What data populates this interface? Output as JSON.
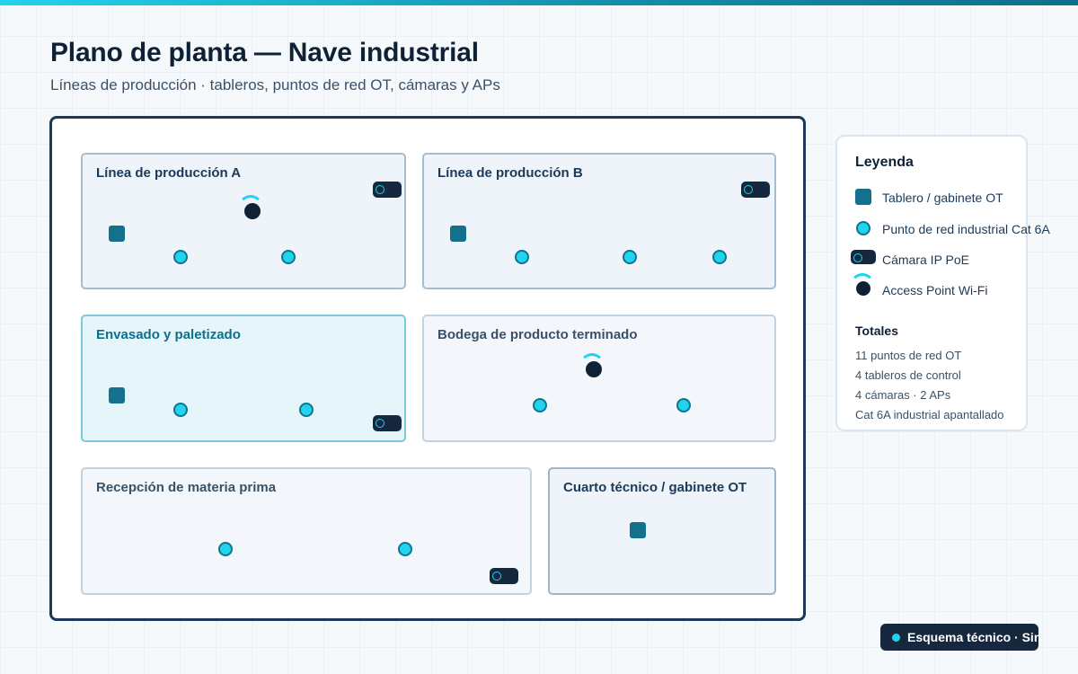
{
  "header": {
    "title": "Plano de planta — Nave industrial",
    "subtitle": "Líneas de producción · tableros, puntos de red OT, cámaras y APs"
  },
  "colors": {
    "accent": "#22d3ee",
    "panel": "#13718d",
    "dark": "#15283e",
    "frame": "#1b3a59"
  },
  "zones": [
    {
      "name": "Línea de producción A",
      "panels": 1,
      "net_points": 2,
      "cameras": 1,
      "aps": 1
    },
    {
      "name": "Línea de producción B",
      "panels": 1,
      "net_points": 3,
      "cameras": 1,
      "aps": 0
    },
    {
      "name": "Envasado y paletizado",
      "panels": 1,
      "net_points": 2,
      "cameras": 1,
      "aps": 0
    },
    {
      "name": "Bodega de producto terminado",
      "panels": 0,
      "net_points": 2,
      "cameras": 0,
      "aps": 1
    },
    {
      "name": "Recepción de materia prima",
      "panels": 0,
      "net_points": 2,
      "cameras": 1,
      "aps": 0
    },
    {
      "name": "Cuarto técnico / gabinete OT",
      "panels": 1,
      "net_points": 0,
      "cameras": 0,
      "aps": 0
    }
  ],
  "legend": {
    "title": "Leyenda",
    "items": [
      {
        "icon": "panel-icon",
        "label": "Tablero / gabinete OT"
      },
      {
        "icon": "network-point-icon",
        "label": "Punto de red industrial Cat 6A"
      },
      {
        "icon": "camera-icon",
        "label": "Cámara IP PoE"
      },
      {
        "icon": "access-point-icon",
        "label": "Access Point Wi-Fi"
      }
    ],
    "totals_title": "Totales",
    "totals": [
      "11 puntos de red OT",
      "4 tableros de control",
      "4 cámaras · 2 APs",
      "Cat 6A industrial apantallado"
    ]
  },
  "badge": {
    "text": "Esquema técnico · Sin"
  }
}
